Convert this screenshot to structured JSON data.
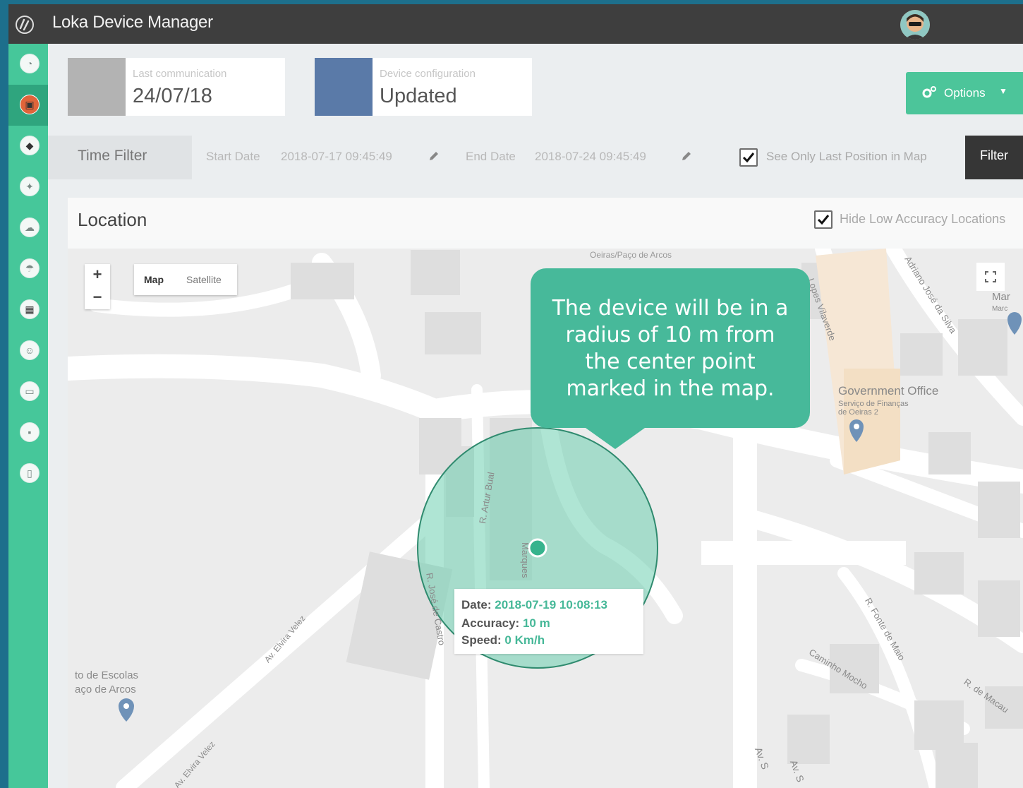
{
  "app": {
    "title": "Loka Device Manager"
  },
  "status_cards": [
    {
      "label": "Last communication",
      "value": "24/07/18",
      "color": "#b3b3b3"
    },
    {
      "label": "Device configuration",
      "value": "Updated",
      "color": "#5a7aa8"
    }
  ],
  "options": {
    "label": "Options"
  },
  "time_filter": {
    "label": "Time Filter",
    "start_label": "Start Date",
    "start_value": "2018-07-17 09:45:49",
    "end_label": "End Date",
    "end_value": "2018-07-24 09:45:49",
    "last_position_label": "See Only Last Position in Map",
    "last_position_checked": true,
    "filter_button": "Filter"
  },
  "location": {
    "title": "Location",
    "hide_low_accuracy_label": "Hide Low Accuracy Locations",
    "hide_low_accuracy_checked": true
  },
  "map": {
    "zoom_in": "+",
    "zoom_out": "−",
    "type_map": "Map",
    "type_satellite": "Satellite",
    "labels": {
      "oeiras": "Oeiras/Paço de Arcos",
      "lopes_vilaverde": "Lopes Vilaverde",
      "adriano": "Adriano José da Silva",
      "mar": "Mar",
      "marc": "Marc",
      "gov_office": "Government Office",
      "gov_sub1": "Serviço de Finanças",
      "gov_sub2": "de Oeiras 2",
      "artur": "R. Artur Bual",
      "jose_castro": "R. José de Castro",
      "marques": "Marques",
      "elvira1": "Av. Elvira Velez",
      "elvira2": "Av. Elvira Velez",
      "escolas1": "to de Escolas",
      "escolas2": "aço de Arcos",
      "fonte": "R. Fonte de Maio",
      "caminho": "Caminho Mocho",
      "macau": "R. de Macau",
      "avs1": "Av. S",
      "avs2": "Av. S"
    }
  },
  "callout": {
    "text": "The device will be in a radius of 10 m from the center point marked in the map."
  },
  "position": {
    "date_label": "Date:",
    "date_value": "2018-07-19 10:08:13",
    "accuracy_label": "Accuracy:",
    "accuracy_value": "10 m",
    "speed_label": "Speed:",
    "speed_value": "0 Km/h"
  },
  "sidebar": {
    "items": [
      {
        "icon": "dashboard-icon"
      },
      {
        "icon": "device-icon",
        "active": true
      },
      {
        "icon": "location-icon"
      },
      {
        "icon": "satellite-icon"
      },
      {
        "icon": "weather-icon"
      },
      {
        "icon": "cloud-icon"
      },
      {
        "icon": "traffic-light-icon"
      },
      {
        "icon": "user-icon"
      },
      {
        "icon": "box-icon"
      },
      {
        "icon": "chat-icon"
      },
      {
        "icon": "document-icon"
      }
    ]
  },
  "colors": {
    "accent": "#46c79a",
    "topbar": "#3e3e3e",
    "accuracy_circle": "#6dcfb0"
  }
}
